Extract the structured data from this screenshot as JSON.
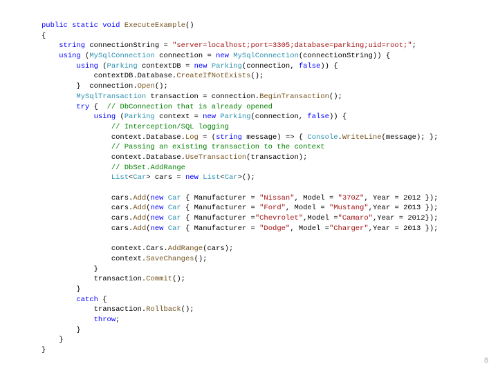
{
  "code": {
    "l1_kw_public": "public",
    "l1_kw_static": "static",
    "l1_kw_void": "void",
    "l1_method": "ExecuteExample",
    "l1_paren": "()",
    "l2": "{",
    "l3_kw_string": "string",
    "l3_var": " connectionString = ",
    "l3_str": "\"server=localhost;port=3305;database=parking;uid=root;\"",
    "l3_end": ";",
    "l4_kw_using": "using",
    "l4_a": " (",
    "l4_type": "MySqlConnection",
    "l4_b": " connection = ",
    "l4_kw_new": "new",
    "l4_c": " ",
    "l4_type2": "MySqlConnection",
    "l4_d": "(connectionString)) {",
    "l5_kw_using": "using",
    "l5_a": " (",
    "l5_type": "Parking",
    "l5_b": " contextDB = ",
    "l5_kw_new": "new",
    "l5_c": " ",
    "l5_type2": "Parking",
    "l5_d": "(connection, ",
    "l5_kw_false": "false",
    "l5_e": ")) {",
    "l6_a": "contextDB.Database.",
    "l6_m": "CreateIfNotExists",
    "l6_b": "();",
    "l7_a": "}  connection.",
    "l7_m": "Open",
    "l7_b": "();",
    "l8_type": "MySqlTransaction",
    "l8_a": " transaction = connection.",
    "l8_m": "BeginTransaction",
    "l8_b": "();",
    "l9_kw_try": "try",
    "l9_a": " {  ",
    "l9_c": "// DbConnection that is already opened",
    "l10_kw_using": "using",
    "l10_a": " (",
    "l10_type": "Parking",
    "l10_b": " context = ",
    "l10_kw_new": "new",
    "l10_c": " ",
    "l10_type2": "Parking",
    "l10_d": "(connection, ",
    "l10_kw_false": "false",
    "l10_e": ")) {",
    "l11_c": "// Interception/SQL logging",
    "l12_a": "context.Database.",
    "l12_m": "Log",
    "l12_b": " = (",
    "l12_kw_string": "string",
    "l12_c": " message) => { ",
    "l12_type": "Console",
    "l12_d": ".",
    "l12_m2": "WriteLine",
    "l12_e": "(message); };",
    "l13_c": "// Passing an existing transaction to the context",
    "l14_a": "context.Database.",
    "l14_m": "UseTransaction",
    "l14_b": "(transaction);",
    "l15_c": "// DbSet.AddRange",
    "l16_type": "List",
    "l16_a": "<",
    "l16_type2": "Car",
    "l16_b": "> cars = ",
    "l16_kw_new": "new",
    "l16_c": " ",
    "l16_type3": "List",
    "l16_d": "<",
    "l16_type4": "Car",
    "l16_e": ">();",
    "l18_a": "cars.",
    "l18_m": "Add",
    "l18_b": "(",
    "l18_kw_new": "new",
    "l18_c": " ",
    "l18_type": "Car",
    "l18_d": " { Manufacturer = ",
    "l18_s1": "\"Nissan\"",
    "l18_e": ", Model = ",
    "l18_s2": "\"370Z\"",
    "l18_f": ", Year = 2012 });",
    "l19_a": "cars.",
    "l19_m": "Add",
    "l19_b": "(",
    "l19_kw_new": "new",
    "l19_c": " ",
    "l19_type": "Car",
    "l19_d": " { Manufacturer = ",
    "l19_s1": "\"Ford\"",
    "l19_e": ", Model = ",
    "l19_s2": "\"Mustang\"",
    "l19_f": ",Year = 2013 });",
    "l20_a": "cars.",
    "l20_m": "Add",
    "l20_b": "(",
    "l20_kw_new": "new",
    "l20_c": " ",
    "l20_type": "Car",
    "l20_d": " { Manufacturer =",
    "l20_s1": "\"Chevrolet\"",
    "l20_e": ",Model =",
    "l20_s2": "\"Camaro\"",
    "l20_f": ",Year = 2012});",
    "l21_a": "cars.",
    "l21_m": "Add",
    "l21_b": "(",
    "l21_kw_new": "new",
    "l21_c": " ",
    "l21_type": "Car",
    "l21_d": " { Manufacturer = ",
    "l21_s1": "\"Dodge\"",
    "l21_e": ", Model =",
    "l21_s2": "\"Charger\"",
    "l21_f": ",Year = 2013 });",
    "l23_a": "context.Cars.",
    "l23_m": "AddRange",
    "l23_b": "(cars);",
    "l24_a": "context.",
    "l24_m": "SaveChanges",
    "l24_b": "();",
    "l25": "}",
    "l26_a": "transaction.",
    "l26_m": "Commit",
    "l26_b": "();",
    "l27": "}",
    "l28_kw_catch": "catch",
    "l28_a": " {",
    "l29_a": "transaction.",
    "l29_m": "Rollback",
    "l29_b": "();",
    "l30_kw_throw": "throw",
    "l30_a": ";",
    "l31": "}",
    "l32": "}",
    "l33": "}"
  },
  "page_number": "8"
}
